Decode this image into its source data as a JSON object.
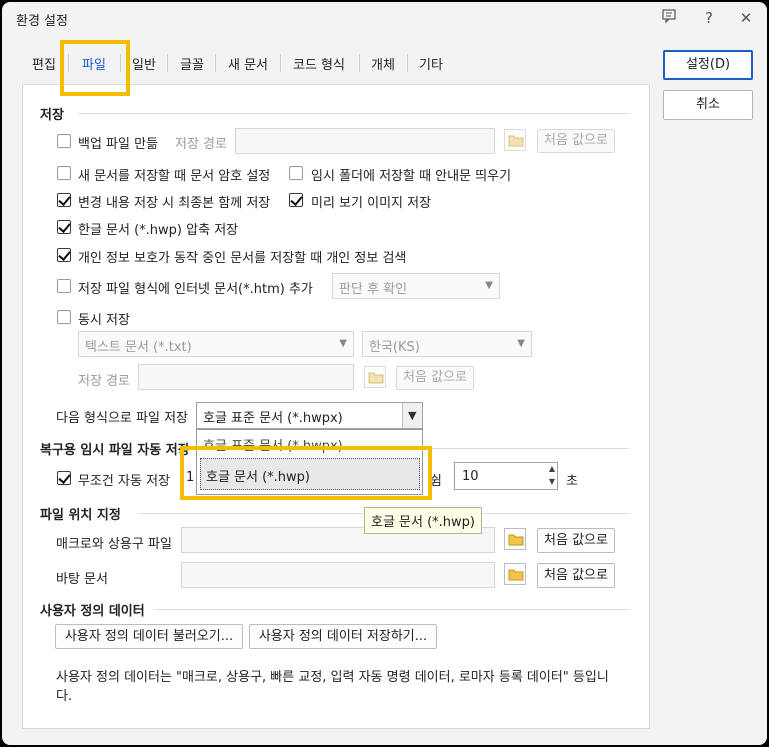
{
  "window": {
    "title": "환경 설정"
  },
  "titlebar": {
    "help_label": "?",
    "close_label": "✕"
  },
  "tabs": [
    {
      "label": "편집"
    },
    {
      "label": "파일"
    },
    {
      "label": "일반"
    },
    {
      "label": "글꼴"
    },
    {
      "label": "새 문서"
    },
    {
      "label": "코드 형식"
    },
    {
      "label": "개체"
    },
    {
      "label": "기타"
    }
  ],
  "active_tab": "파일",
  "actions": {
    "ok_label": "설정(D)",
    "cancel_label": "취소"
  },
  "save": {
    "title": "저장",
    "backup_label": "백업 파일 만듦",
    "backup_checked": false,
    "path_label": "저장 경로",
    "path_value": "",
    "reset_label": "처음 값으로",
    "password_label": "새 문서를 저장할 때 문서 암호 설정",
    "password_checked": false,
    "temp_guide_label": "임시 폴더에 저장할 때 안내문 띄우기",
    "temp_guide_checked": false,
    "latest_label": "변경 내용 저장 시 최종본 함께 저장",
    "latest_checked": true,
    "preview_label": "미리 보기 이미지 저장",
    "preview_checked": true,
    "compress_label": "한글 문서 (*.hwp) 압축 저장",
    "compress_checked": true,
    "privacy_label": "개인 정보 보호가 동작 중인 문서를 저장할 때 개인 정보 검색",
    "privacy_checked": true,
    "internet_label": "저장 파일 형식에 인터넷 문서(*.htm) 추가",
    "internet_checked": false,
    "internet_option": "판단 후 확인",
    "simul_label": "동시 저장",
    "simul_checked": false,
    "simul_format": "텍스트 문서 (*.txt)",
    "simul_encoding": "한국(KS)",
    "simul_path_label": "저장 경로",
    "simul_reset_label": "처음 값으로",
    "format_label": "다음 형식으로 파일 저장",
    "format_value": "호글 표준 문서 (*.hwpx)",
    "format_options": [
      "호글 표준 문서 (*.hwpx)",
      "호글 문서 (*.hwp)"
    ],
    "format_highlighted": "호글 문서 (*.hwp)"
  },
  "recovery": {
    "title": "복구용 임시 파일 자동 저장",
    "auto_label": "무조건 자동 저장",
    "auto_checked": true,
    "auto_prefix": "1",
    "idle_tail": "쉼",
    "interval_value": "10",
    "unit": "초"
  },
  "tooltip": {
    "text": "호글 문서 (*.hwp)"
  },
  "location": {
    "title": "파일 위치 지정",
    "macro_label": "매크로와 상용구 파일",
    "macro_reset": "처음 값으로",
    "desktop_label": "바탕 문서",
    "desktop_reset": "처음 값으로"
  },
  "user_data": {
    "title": "사용자 정의 데이터",
    "load_label": "사용자 정의 데이터 불러오기...",
    "save_label": "사용자 정의 데이터 저장하기...",
    "description": "사용자 정의 데이터는 \"매크로, 상용구, 빠른 교정, 입력 자동 명령 데이터, 로마자 등록 데이터\" 등입니다."
  },
  "colors": {
    "accent": "#1a5fc8",
    "highlight": "#f5bd00",
    "tooltip_bg": "#fffde6"
  }
}
